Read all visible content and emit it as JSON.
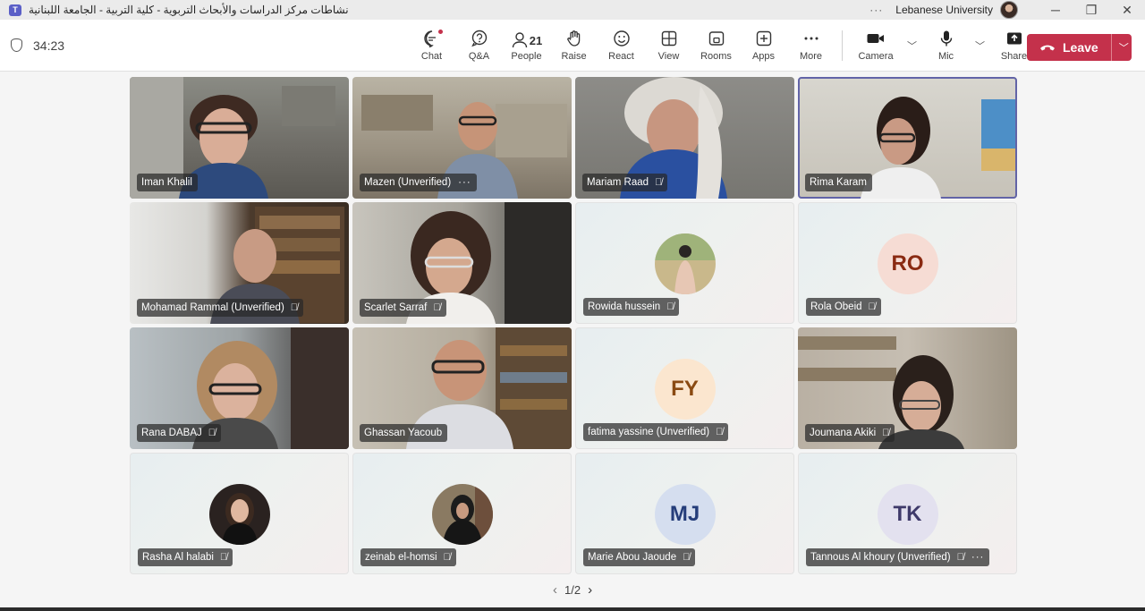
{
  "window": {
    "title": "نشاطات مركز الدراسات والأبحاث التربوية - كلية التربية - الجامعة اللبنانية",
    "org": "Lebanese University",
    "more": "···"
  },
  "toolbar": {
    "timer": "34:23",
    "chat": "Chat",
    "qa": "Q&A",
    "people": "People",
    "people_count": "21",
    "raise": "Raise",
    "react": "React",
    "view": "View",
    "rooms": "Rooms",
    "apps": "Apps",
    "more": "More",
    "camera": "Camera",
    "mic": "Mic",
    "share": "Share",
    "leave": "Leave"
  },
  "participants": [
    {
      "name": "Iman Khalil",
      "muted": false,
      "kind": "video"
    },
    {
      "name": "Mazen (Unverified)",
      "muted": false,
      "kind": "video",
      "more": "···"
    },
    {
      "name": "Mariam Raad",
      "muted": true,
      "kind": "video"
    },
    {
      "name": "Rima Karam",
      "muted": false,
      "kind": "video",
      "active": true
    },
    {
      "name": "Mohamad Rammal (Unverified)",
      "muted": true,
      "kind": "video"
    },
    {
      "name": "Scarlet Sarraf",
      "muted": true,
      "kind": "video"
    },
    {
      "name": "Rowida hussein",
      "muted": true,
      "kind": "photo"
    },
    {
      "name": "Rola Obeid",
      "muted": true,
      "kind": "initials",
      "initials": "RO",
      "color": "#8a2a12",
      "avatar_bg": "#f6dcd4"
    },
    {
      "name": "Rana DABAJ",
      "muted": true,
      "kind": "video"
    },
    {
      "name": "Ghassan Yacoub",
      "muted": false,
      "kind": "video"
    },
    {
      "name": "fatima yassine (Unverified)",
      "muted": true,
      "kind": "initials",
      "initials": "FY",
      "color": "#8a4a12",
      "avatar_bg": "#fbe6cf"
    },
    {
      "name": "Joumana Akiki",
      "muted": true,
      "kind": "video"
    },
    {
      "name": "Rasha Al halabi",
      "muted": true,
      "kind": "photo"
    },
    {
      "name": "zeinab el-homsi",
      "muted": true,
      "kind": "photo"
    },
    {
      "name": "Marie Abou Jaoude",
      "muted": true,
      "kind": "initials",
      "initials": "MJ",
      "color": "#253d7a",
      "avatar_bg": "#d5deef"
    },
    {
      "name": "Tannous Al khoury (Unverified)",
      "muted": true,
      "kind": "initials",
      "initials": "TK",
      "color": "#3f3a6a",
      "avatar_bg": "#e3e1ef",
      "more": "···"
    }
  ],
  "pager": {
    "label": "1/2",
    "prev": "‹",
    "next": "›"
  },
  "colors": {
    "leave": "#c4314b",
    "accent": "#6264a7"
  }
}
